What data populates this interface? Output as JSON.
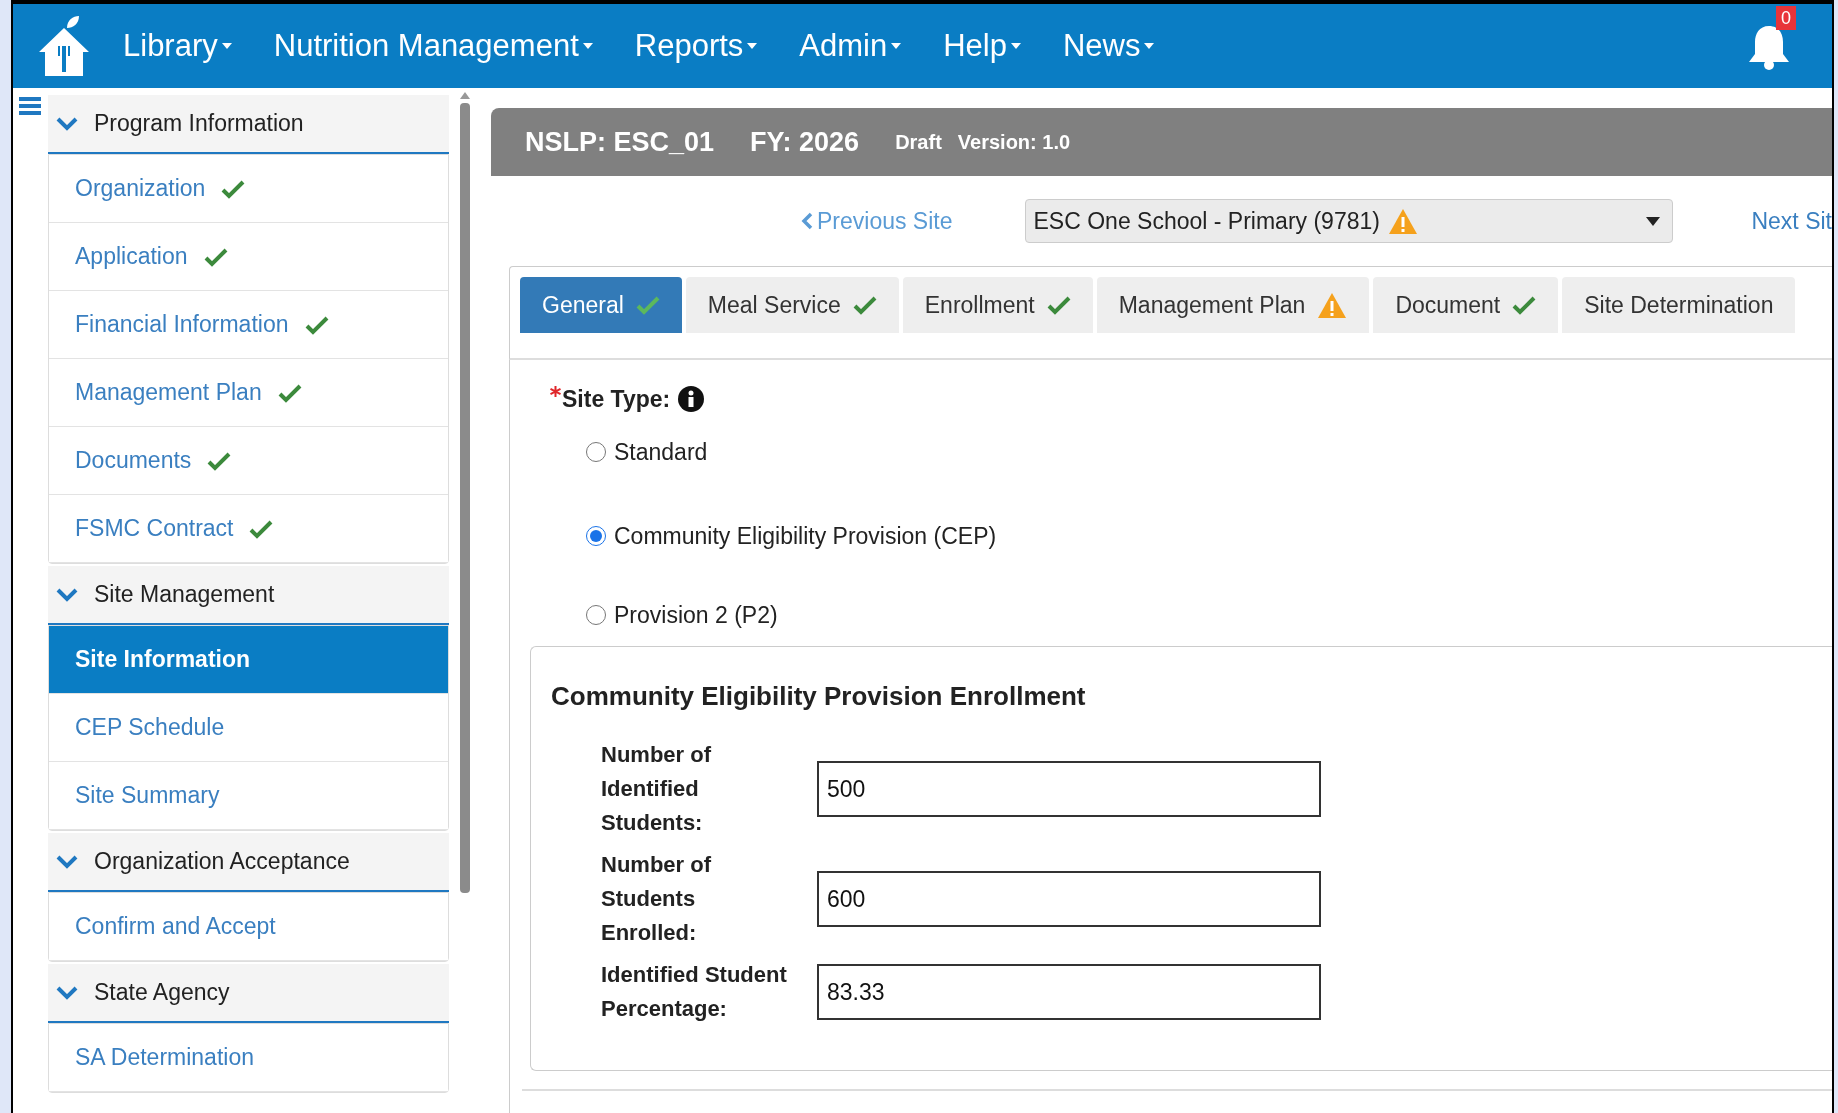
{
  "nav": {
    "menus": [
      "Library",
      "Nutrition Management",
      "Reports",
      "Admin",
      "Help",
      "News"
    ],
    "notification_count": "0"
  },
  "sidebar": {
    "sections": [
      {
        "title": "Program Information",
        "expanded": true,
        "items": [
          {
            "label": "Organization",
            "kind": "complete",
            "selected": false
          },
          {
            "label": "Application",
            "kind": "complete",
            "selected": false
          },
          {
            "label": "Financial Information",
            "kind": "complete",
            "selected": false
          },
          {
            "label": "Management Plan",
            "kind": "complete",
            "selected": false
          },
          {
            "label": "Documents",
            "kind": "complete",
            "selected": false
          },
          {
            "label": "FSMC Contract",
            "kind": "complete",
            "selected": false
          }
        ]
      },
      {
        "title": "Site Management",
        "expanded": true,
        "items": [
          {
            "label": "Site Information",
            "kind": "plain",
            "selected": true
          },
          {
            "label": "CEP Schedule",
            "kind": "plain",
            "selected": false
          },
          {
            "label": "Site Summary",
            "kind": "plain",
            "selected": false
          }
        ]
      },
      {
        "title": "Organization Acceptance",
        "expanded": true,
        "items": [
          {
            "label": "Confirm and Accept",
            "kind": "plain",
            "selected": false
          }
        ]
      },
      {
        "title": "State Agency",
        "expanded": true,
        "items": [
          {
            "label": "SA Determination",
            "kind": "plain",
            "selected": false
          }
        ]
      }
    ]
  },
  "header": {
    "program": "NSLP: ESC_01",
    "fiscal_year": "FY: 2026",
    "status": "Draft",
    "version": "Version: 1.0"
  },
  "site_nav": {
    "previous": "Previous Site",
    "site": {
      "label": "ESC One School - Primary (9781)",
      "kind": "warning"
    },
    "next": "Next Sit"
  },
  "tabs": [
    {
      "label": "General",
      "kind": "complete",
      "selected": true
    },
    {
      "label": "Meal Service",
      "kind": "complete",
      "selected": false
    },
    {
      "label": "Enrollment",
      "kind": "complete",
      "selected": false
    },
    {
      "label": "Management Plan",
      "kind": "warning",
      "selected": false
    },
    {
      "label": "Document",
      "kind": "complete",
      "selected": false
    },
    {
      "label": "Site Determination",
      "kind": "plain",
      "selected": false
    }
  ],
  "site_type": {
    "label": "Site Type:",
    "required": true,
    "options": [
      {
        "label": "Standard",
        "selected": false
      },
      {
        "label": "Community Eligibility Provision (CEP)",
        "selected": true
      },
      {
        "label": "Provision 2 (P2)",
        "selected": false
      }
    ]
  },
  "cep_enrollment": {
    "title": "Community Eligibility Provision Enrollment",
    "fields": [
      {
        "label": "Number of Identified Students:",
        "value": "500"
      },
      {
        "label": "Number of Students Enrolled:",
        "value": "600"
      },
      {
        "label": "Identified Student Percentage:",
        "value": "83.33"
      }
    ]
  }
}
